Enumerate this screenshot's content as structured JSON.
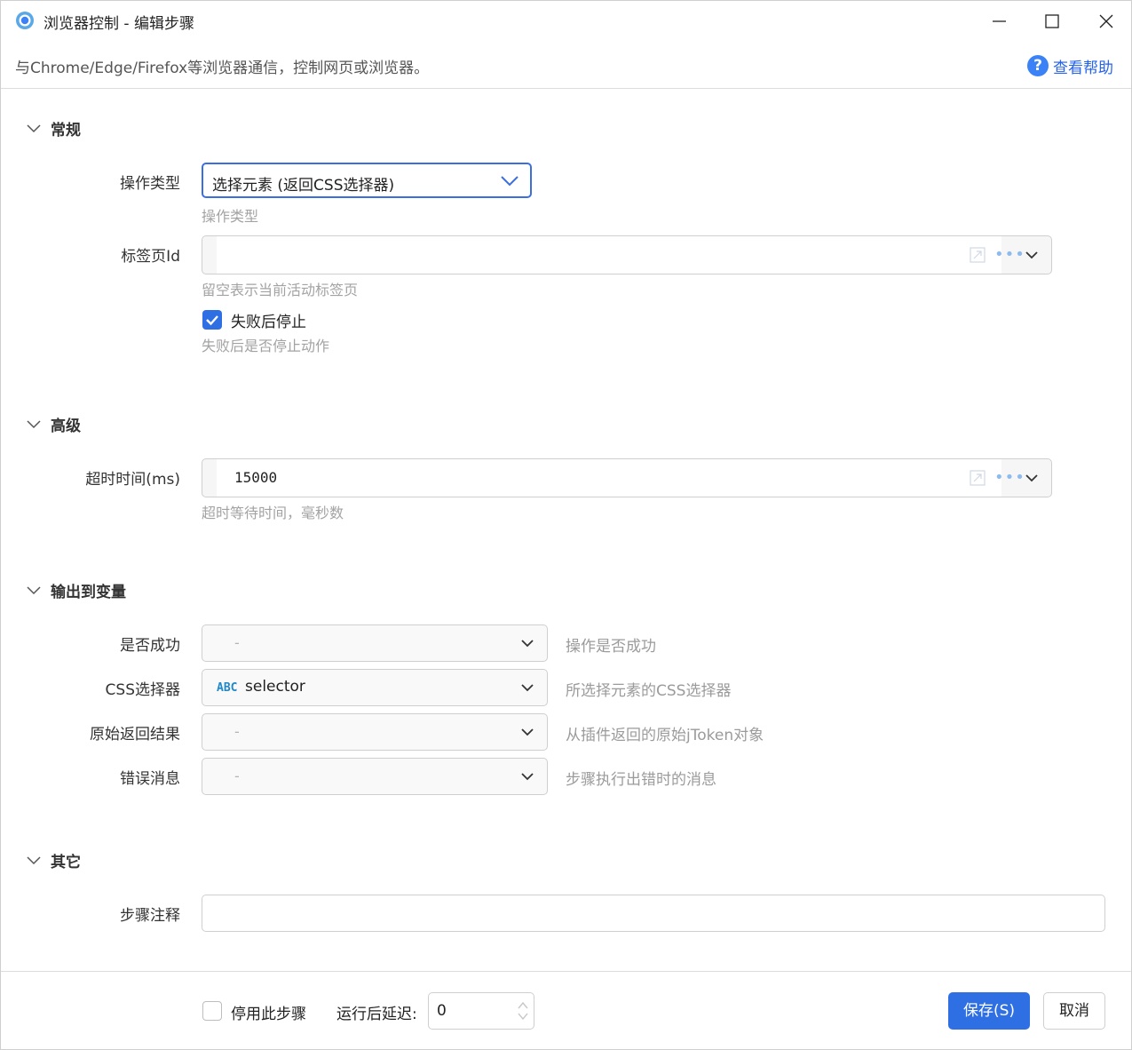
{
  "window": {
    "title": "浏览器控制  -  编辑步骤",
    "subtitle": "与Chrome/Edge/Firefox等浏览器通信，控制网页或浏览器。",
    "help_label": "查看帮助",
    "help_glyph": "?"
  },
  "sections": {
    "general": {
      "title": "常规",
      "op_type": {
        "label": "操作类型",
        "value": "选择元素 (返回CSS选择器)",
        "hint": "操作类型"
      },
      "tab_id": {
        "label": "标签页Id",
        "value": "",
        "hint": "留空表示当前活动标签页"
      },
      "stop_on_fail": {
        "label": "失败后停止",
        "checked": true,
        "hint": "失败后是否停止动作"
      }
    },
    "advanced": {
      "title": "高级",
      "timeout": {
        "label": "超时时间(ms)",
        "value": "15000",
        "hint": "超时等待时间，毫秒数"
      }
    },
    "output": {
      "title": "输出到变量",
      "rows": [
        {
          "label": "是否成功",
          "value": "-",
          "hint": "操作是否成功"
        },
        {
          "label": "CSS选择器",
          "type_badge": "ABC",
          "value": "selector",
          "hint": "所选择元素的CSS选择器"
        },
        {
          "label": "原始返回结果",
          "value": "-",
          "hint": "从插件返回的原始jToken对象"
        },
        {
          "label": "错误消息",
          "value": "-",
          "hint": "步骤执行出错时的消息"
        }
      ]
    },
    "other": {
      "title": "其它",
      "note": {
        "label": "步骤注释",
        "value": ""
      }
    }
  },
  "footer": {
    "disable_label": "停用此步骤",
    "disable_checked": false,
    "delay_label": "运行后延迟:",
    "delay_value": "0",
    "save_label": "保存(S)",
    "cancel_label": "取消"
  },
  "colors": {
    "accent": "#2f6fe4",
    "link": "#2563eb",
    "hint": "#a3a3a3",
    "badge": "#1e88c8"
  }
}
